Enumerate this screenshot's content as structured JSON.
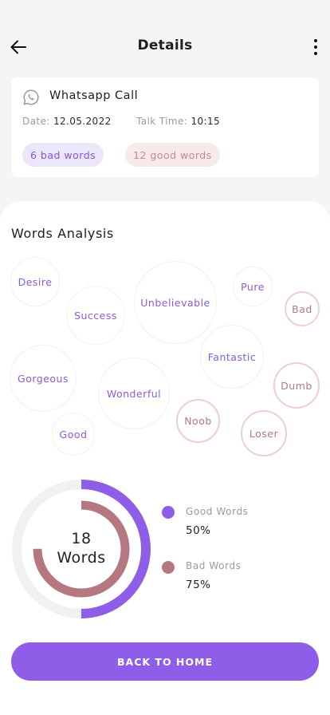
{
  "header": {
    "title": "Details"
  },
  "call": {
    "name": "Whatsapp Call",
    "date_label": "Date:",
    "date_value": "12.05.2022",
    "talk_label": "Talk Time:",
    "talk_value": "10:15",
    "bad_pill": "6 bad words",
    "good_pill": "12 good words"
  },
  "analysis": {
    "title": "Words Analysis",
    "bubbles": {
      "desire": "Desire",
      "success": "Success",
      "unbelievable": "Unbelievable",
      "pure": "Pure",
      "bad": "Bad",
      "fantastic": "Fantastic",
      "gorgeous": "Gorgeous",
      "wonderful": "Wonderful",
      "dumb": "Dumb",
      "noob": "Noob",
      "loser": "Loser",
      "good": "Good"
    }
  },
  "summary": {
    "total_number": "18",
    "total_unit": "Words",
    "good_label": "Good Words",
    "good_value": "50%",
    "bad_label": "Bad Words",
    "bad_value": "75%",
    "good_fraction": 0.5,
    "bad_fraction": 0.75,
    "good_color": "#8e5ee8",
    "bad_color": "#b57880",
    "track_color": "#f1f1f2"
  },
  "footer": {
    "home_button": "BACK TO HOME"
  }
}
